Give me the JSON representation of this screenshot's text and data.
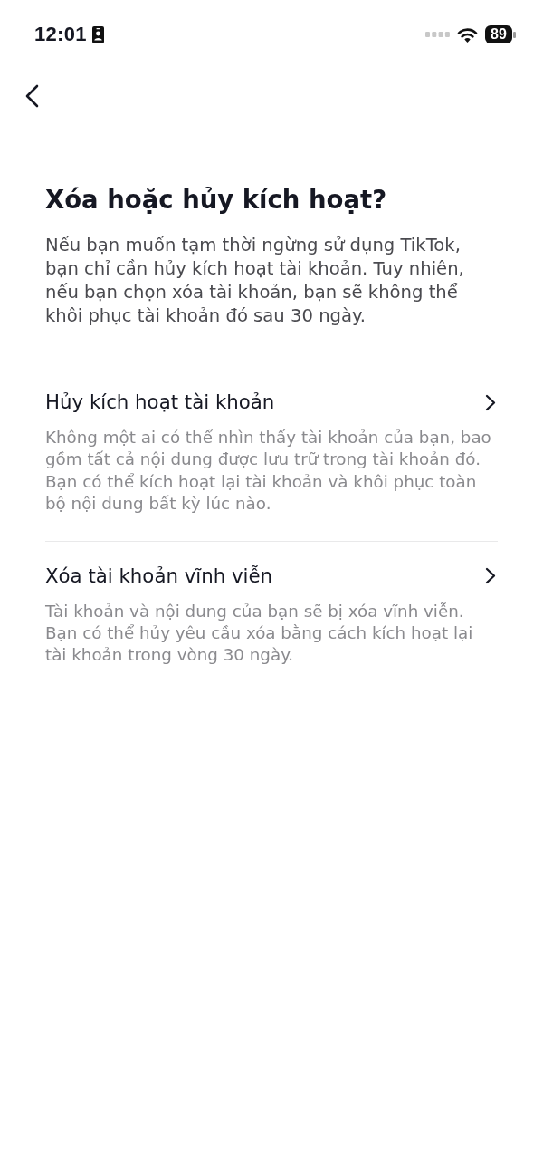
{
  "status_bar": {
    "time": "12:01",
    "battery": "89"
  },
  "title": "Xóa hoặc hủy kích hoạt?",
  "intro": "Nếu bạn muốn tạm thời ngừng sử dụng TikTok, bạn chỉ cần hủy kích hoạt tài khoản. Tuy nhiên, nếu bạn chọn xóa tài khoản, bạn sẽ không thể khôi phục tài khoản đó sau 30 ngày.",
  "options": [
    {
      "title": "Hủy kích hoạt tài khoản",
      "description": "Không một ai có thể nhìn thấy tài khoản của bạn, bao gồm tất cả nội dung được lưu trữ trong tài khoản đó. Bạn có thể kích hoạt lại tài khoản và khôi phục toàn bộ nội dung bất kỳ lúc nào."
    },
    {
      "title": "Xóa tài khoản vĩnh viễn",
      "description": "Tài khoản và nội dung của bạn sẽ bị xóa vĩnh viễn. Bạn có thể hủy yêu cầu xóa bằng cách kích hoạt lại tài khoản trong vòng 30 ngày."
    }
  ]
}
